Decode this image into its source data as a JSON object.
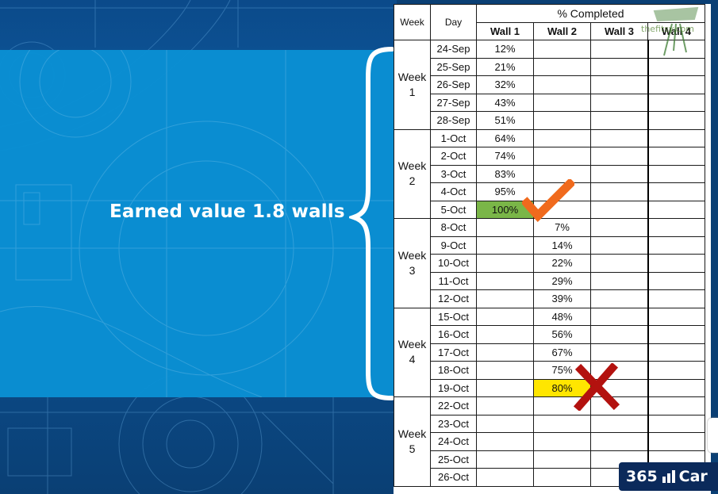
{
  "slide": {
    "headline": "Earned value 1.8 walls"
  },
  "table": {
    "header_week": "Week",
    "header_day": "Day",
    "header_group": "% Completed",
    "walls": [
      "Wall 1",
      "Wall 2",
      "Wall 3",
      "Wall 4"
    ],
    "weeks": [
      {
        "label": "Week 1",
        "rows": [
          {
            "day": "24-Sep",
            "w1": "12%",
            "w2": ""
          },
          {
            "day": "25-Sep",
            "w1": "21%",
            "w2": ""
          },
          {
            "day": "26-Sep",
            "w1": "32%",
            "w2": ""
          },
          {
            "day": "27-Sep",
            "w1": "43%",
            "w2": ""
          },
          {
            "day": "28-Sep",
            "w1": "51%",
            "w2": ""
          }
        ]
      },
      {
        "label": "Week 2",
        "rows": [
          {
            "day": "1-Oct",
            "w1": "64%",
            "w2": ""
          },
          {
            "day": "2-Oct",
            "w1": "74%",
            "w2": ""
          },
          {
            "day": "3-Oct",
            "w1": "83%",
            "w2": ""
          },
          {
            "day": "4-Oct",
            "w1": "95%",
            "w2": ""
          },
          {
            "day": "5-Oct",
            "w1": "100%",
            "w2": "",
            "hl_w1": "green"
          }
        ]
      },
      {
        "label": "Week 3",
        "rows": [
          {
            "day": "8-Oct",
            "w1": "",
            "w2": "7%"
          },
          {
            "day": "9-Oct",
            "w1": "",
            "w2": "14%"
          },
          {
            "day": "10-Oct",
            "w1": "",
            "w2": "22%"
          },
          {
            "day": "11-Oct",
            "w1": "",
            "w2": "29%"
          },
          {
            "day": "12-Oct",
            "w1": "",
            "w2": "39%"
          }
        ]
      },
      {
        "label": "Week 4",
        "rows": [
          {
            "day": "15-Oct",
            "w1": "",
            "w2": "48%"
          },
          {
            "day": "16-Oct",
            "w1": "",
            "w2": "56%"
          },
          {
            "day": "17-Oct",
            "w1": "",
            "w2": "67%"
          },
          {
            "day": "18-Oct",
            "w1": "",
            "w2": "75%"
          },
          {
            "day": "19-Oct",
            "w1": "",
            "w2": "80%",
            "hl_w2": "yellow"
          }
        ]
      },
      {
        "label": "Week 5",
        "rows": [
          {
            "day": "22-Oct",
            "w1": "",
            "w2": "",
            "bold": true
          },
          {
            "day": "23-Oct",
            "w1": "",
            "w2": ""
          },
          {
            "day": "24-Oct",
            "w1": "",
            "w2": ""
          },
          {
            "day": "25-Oct",
            "w1": "",
            "w2": ""
          },
          {
            "day": "26-Oct",
            "w1": "",
            "w2": ""
          }
        ]
      }
    ]
  },
  "watermark": {
    "text": "thefitsy.com",
    "icon": "leaf-logo-icon"
  },
  "marks": {
    "check_icon": "check-icon",
    "check_color": "#f06a1d",
    "x_icon": "cross-icon",
    "x_color": "#b3120f"
  },
  "brand": {
    "prefix": "365",
    "suffix": "Car"
  },
  "colors": {
    "panel": "#0a90d4",
    "highlight_green": "#7ab648",
    "highlight_yellow": "#ffe600",
    "badge": "#0b2a5b"
  }
}
